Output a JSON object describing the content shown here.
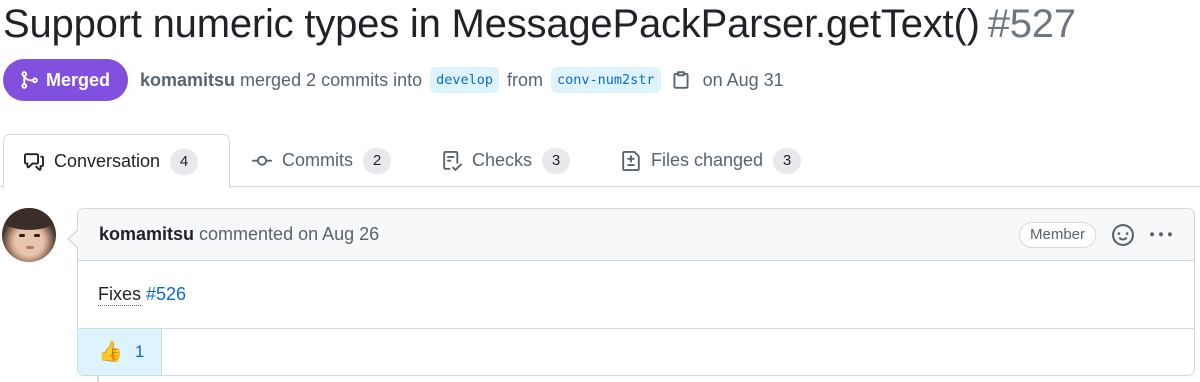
{
  "pr": {
    "title": "Support numeric types in MessagePackParser.getText()",
    "number": "#527",
    "state": "Merged",
    "author": "komamitsu",
    "action": "merged 2 commits into",
    "base_branch": "develop",
    "from_label": "from",
    "head_branch": "conv-num2str",
    "date": "on Aug 31"
  },
  "tabs": [
    {
      "label": "Conversation",
      "count": "4",
      "icon": "comment-discussion-icon"
    },
    {
      "label": "Commits",
      "count": "2",
      "icon": "git-commit-icon"
    },
    {
      "label": "Checks",
      "count": "3",
      "icon": "checklist-icon"
    },
    {
      "label": "Files changed",
      "count": "3",
      "icon": "file-diff-icon"
    }
  ],
  "comment": {
    "author": "komamitsu",
    "action": "commented on Aug 26",
    "role": "Member",
    "body_prefix": "Fixes",
    "body_link": "#526",
    "reaction_emoji": "👍",
    "reaction_count": "1"
  },
  "colors": {
    "merged": "#8250df",
    "link": "#0969da",
    "muted": "#59636e",
    "border": "#d1d9e0"
  }
}
